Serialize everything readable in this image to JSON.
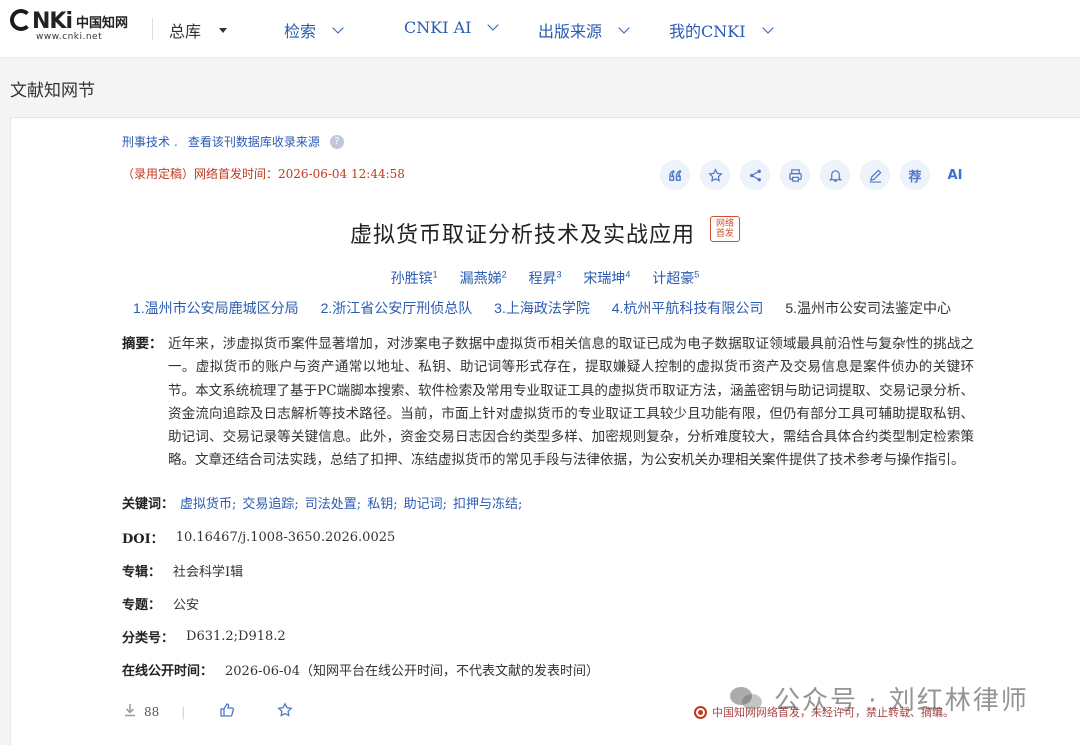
{
  "nav": {
    "logo_mark": "NKi",
    "logo_cn": "中国知网",
    "logo_url": "www.cnki.net",
    "library": "总库",
    "items": [
      "检索",
      "CNKI AI",
      "出版来源",
      "我的CNKI"
    ]
  },
  "section_title": "文献知网节",
  "article": {
    "source_journal": "刑事技术",
    "source_link": "查看该刊数据库收录来源",
    "pub_status": "（录用定稿）网络首发时间：2026-06-04 12:44:58",
    "toolbar": [
      "quote-icon",
      "star-icon",
      "share-icon",
      "print-icon",
      "bell-icon",
      "pen-icon",
      "荐",
      "AI"
    ],
    "title": "虚拟货币取证分析技术及实战应用",
    "badge": "网络首发",
    "authors": [
      {
        "name": "孙胜镔",
        "sup": "1"
      },
      {
        "name": "漏燕娣",
        "sup": "2"
      },
      {
        "name": "程昇",
        "sup": "3"
      },
      {
        "name": "宋瑞坤",
        "sup": "4"
      },
      {
        "name": "计超豪",
        "sup": "5"
      }
    ],
    "affiliations": [
      "1.温州市公安局鹿城区分局",
      "2.浙江省公安厅刑侦总队",
      "3.上海政法学院",
      "4.杭州平航科技有限公司",
      "5.温州市公安司法鉴定中心"
    ],
    "abstract_label": "摘要：",
    "abstract": "近年来，涉虚拟货币案件显著增加，对涉案电子数据中虚拟货币相关信息的取证已成为电子数据取证领域最具前沿性与复杂性的挑战之一。虚拟货币的账户与资产通常以地址、私钥、助记词等形式存在，提取嫌疑人控制的虚拟货币资产及交易信息是案件侦办的关键环节。本文系统梳理了基于PC端脚本搜索、软件检索及常用专业取证工具的虚拟货币取证方法，涵盖密钥与助记词提取、交易记录分析、资金流向追踪及日志解析等技术路径。当前，市面上针对虚拟货币的专业取证工具较少且功能有限，但仍有部分工具可辅助提取私钥、助记词、交易记录等关键信息。此外，资金交易日志因合约类型多样、加密规则复杂，分析难度较大，需结合具体合约类型制定检索策略。文章还结合司法实践，总结了扣押、冻结虚拟货币的常见手段与法律依据，为公安机关办理相关案件提供了技术参考与操作指引。",
    "keywords_label": "关键词：",
    "keywords": [
      "虚拟货币;",
      "交易追踪;",
      "司法处置;",
      "私钥;",
      "助记词;",
      "扣押与冻结;"
    ],
    "doi_label": "DOI：",
    "doi": "10.16467/j.1008-3650.2026.0025",
    "series_label": "专辑：",
    "series": "社会科学I辑",
    "topic_label": "专题：",
    "topic": "公安",
    "class_label": "分类号：",
    "class_no": "D631.2;D918.2",
    "online_label": "在线公开时间：",
    "online_time": "2026-06-04（知网平台在线公开时间，不代表文献的发表时间）",
    "downloads": "88",
    "notice": "中国知网网络首发，未经许可，禁止转载、摘编。"
  },
  "watermark": "公众号 · 刘红林律师",
  "colors": {
    "link": "#2b5bb3",
    "alert": "#c0391f",
    "badge": "#d0502f"
  }
}
